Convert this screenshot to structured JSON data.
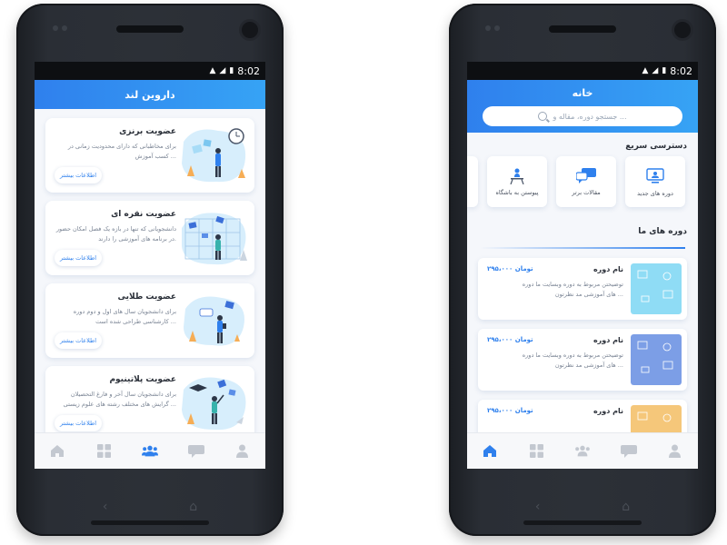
{
  "status": {
    "time": "8:02"
  },
  "left_screen": {
    "title": "داروین لند",
    "cards": [
      {
        "title": "عضویت برنزی",
        "desc": "برای مخاطبانی که دارای محدودیت زمانی در کسب آموزش ...",
        "button": "اطلاعات بیشتر"
      },
      {
        "title": "عضویت نقره ای",
        "desc": "دانشجویانی که تنها در بازه یک فصل امکان حضور در برنامه های آموزشی را دارند.",
        "button": "اطلاعات بیشتر"
      },
      {
        "title": "عضویت طلایی",
        "desc": "برای دانشجویان سال های اول و دوم دوره کارشناسی طراحی شده است ...",
        "button": "اطلاعات بیشتر"
      },
      {
        "title": "عضویت پلاتینیوم",
        "desc": "برای دانشجویان سال آخر و فارغ التحصیلان گرایش های مختلف رشته های علوم زیستی ...",
        "button": "اطلاعات بیشتر"
      }
    ],
    "tabs": [
      "home-icon",
      "grid-icon",
      "users-icon",
      "chat-icon",
      "profile-icon"
    ],
    "active_tab": 2
  },
  "right_screen": {
    "title": "خانه",
    "search_placeholder": "جستجو دوره، مقاله و ...",
    "quick_title": "دسترسی سریع",
    "quick_items": [
      {
        "label": "دوره های جدید",
        "icon": "monitor-icon"
      },
      {
        "label": "مقالات برتر",
        "icon": "chat-bubble-icon"
      },
      {
        "label": "پیوستن به باشگاه",
        "icon": "team-icon"
      }
    ],
    "courses_title": "دوره های ما",
    "courses": [
      {
        "name": "نام دوره",
        "price": "۲۹۵،۰۰۰ تومان",
        "desc": "توضیحتن مربوط به دوره وبسایت ما دوره های آموزشی مد نظرتون ...",
        "color": "#8fdcf5"
      },
      {
        "name": "نام دوره",
        "price": "۲۹۵،۰۰۰ تومان",
        "desc": "توضیحتن مربوط به دوره وبسایت ما دوره های آموزشی مد نظرتون ...",
        "color": "#7c9ee6"
      },
      {
        "name": "نام دوره",
        "price": "۲۹۵،۰۰۰ تومان",
        "desc": "",
        "color": "#f5c77a"
      }
    ],
    "tabs": [
      "home-icon",
      "grid-icon",
      "users-icon",
      "chat-icon",
      "profile-icon"
    ],
    "active_tab": 0
  },
  "colors": {
    "accent": "#2f80ed",
    "inactive": "#c3c8d0"
  }
}
